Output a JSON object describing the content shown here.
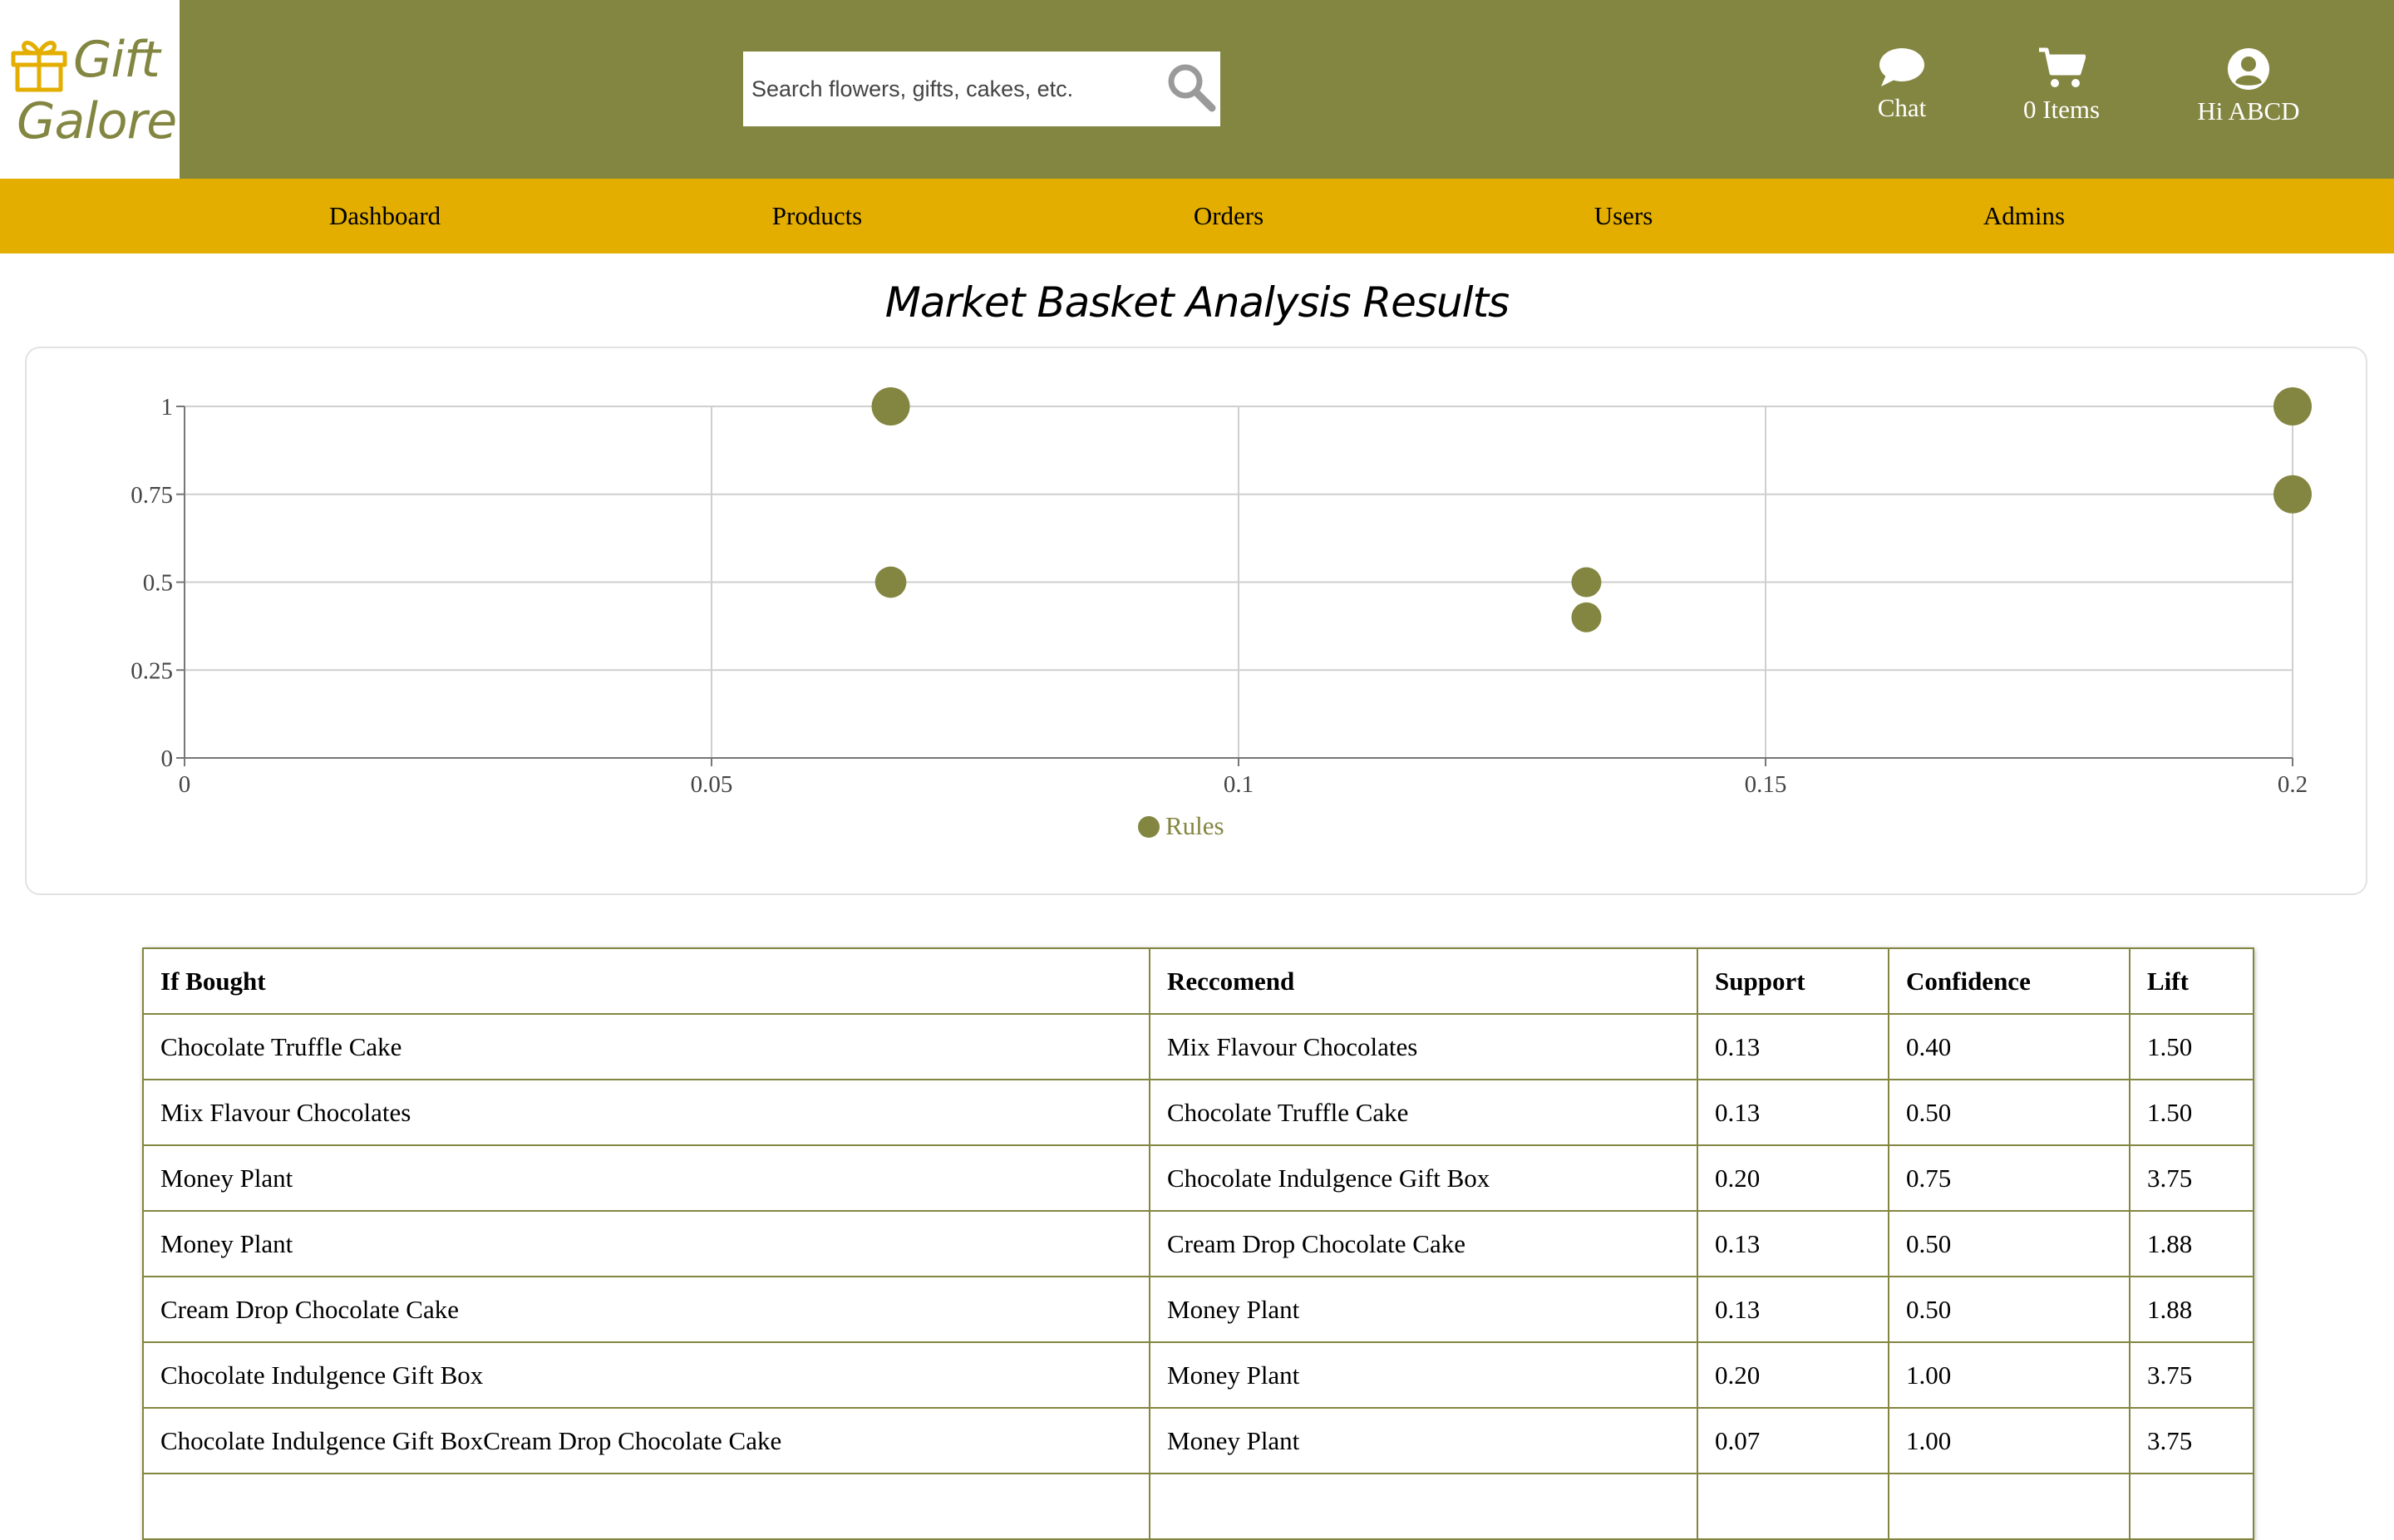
{
  "brand": {
    "line1": "Gift",
    "line2": "Galore",
    "color": "#838640"
  },
  "search": {
    "placeholder": "Search flowers, gifts, cakes, etc.",
    "icon": "search-icon"
  },
  "header": {
    "chat_label": "Chat",
    "cart_label": "0 Items",
    "user_label": "Hi ABCD",
    "bg_color": "#838640"
  },
  "nav": {
    "bg_color": "#e3ae00",
    "items": [
      {
        "label": "Dashboard"
      },
      {
        "label": "Products"
      },
      {
        "label": "Orders"
      },
      {
        "label": "Users"
      },
      {
        "label": "Admins"
      }
    ]
  },
  "page": {
    "title": "Market Basket Analysis Results"
  },
  "chart_data": {
    "type": "scatter",
    "title": "",
    "xlabel": "",
    "ylabel": "",
    "xlim": [
      0,
      0.2
    ],
    "ylim": [
      0,
      1
    ],
    "x_ticks": [
      "0",
      "0.05",
      "0.1",
      "0.15",
      "0.2"
    ],
    "y_ticks": [
      "0",
      "0.25",
      "0.5",
      "0.75",
      "1"
    ],
    "grid": true,
    "legend_position": "bottom",
    "series": [
      {
        "name": "Rules",
        "color": "#838640",
        "points": [
          {
            "x": 0.133,
            "y": 0.4,
            "lift": 1.5
          },
          {
            "x": 0.133,
            "y": 0.5,
            "lift": 1.5
          },
          {
            "x": 0.2,
            "y": 0.75,
            "lift": 3.75
          },
          {
            "x": 0.067,
            "y": 0.5,
            "lift": 1.88
          },
          {
            "x": 0.067,
            "y": 1.0,
            "lift": 3.75
          },
          {
            "x": 0.2,
            "y": 1.0,
            "lift": 3.75
          }
        ]
      }
    ]
  },
  "table": {
    "headers": [
      "If Bought",
      "Reccomend",
      "Support",
      "Confidence",
      "Lift"
    ],
    "rows": [
      [
        "Chocolate Truffle Cake",
        "Mix Flavour Chocolates",
        "0.13",
        "0.40",
        "1.50"
      ],
      [
        "Mix Flavour Chocolates",
        "Chocolate Truffle Cake",
        "0.13",
        "0.50",
        "1.50"
      ],
      [
        "Money Plant",
        "Chocolate Indulgence Gift Box",
        "0.20",
        "0.75",
        "3.75"
      ],
      [
        "Money Plant",
        "Cream Drop Chocolate Cake",
        "0.13",
        "0.50",
        "1.88"
      ],
      [
        "Cream Drop Chocolate Cake",
        "Money Plant",
        "0.13",
        "0.50",
        "1.88"
      ],
      [
        "Chocolate Indulgence Gift Box",
        "Money Plant",
        "0.20",
        "1.00",
        "3.75"
      ],
      [
        "Chocolate Indulgence Gift BoxCream Drop Chocolate Cake",
        "Money Plant",
        "0.07",
        "1.00",
        "3.75"
      ],
      [
        "",
        "",
        "",
        "",
        ""
      ]
    ]
  }
}
